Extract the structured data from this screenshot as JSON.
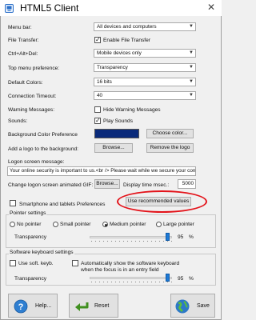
{
  "window": {
    "title": "HTML5 Client",
    "close_glyph": "✕"
  },
  "settings": {
    "menu_bar": {
      "label": "Menu bar:",
      "value": "All devices and computers"
    },
    "file_transfer": {
      "label": "File Transfer:",
      "checkbox_label": "Enable File Transfer",
      "checked": true
    },
    "ctrl_alt_del": {
      "label": "Ctrl+Alt+Del:",
      "value": "Mobile devices only"
    },
    "top_menu_pref": {
      "label": "Top menu preference:",
      "value": "Transparency"
    },
    "default_colors": {
      "label": "Default Colors:",
      "value": "16 bits"
    },
    "connection_timeout": {
      "label": "Connection Timeout:",
      "value": "40"
    },
    "warning_messages": {
      "label": "Warning Messages:",
      "checkbox_label": "Hide Warning Messages",
      "checked": false
    },
    "sounds": {
      "label": "Sounds:",
      "checkbox_label": "Play Sounds",
      "checked": true
    },
    "background_color": {
      "label": "Background Color Preference",
      "swatch": "#0a2a7a",
      "button": "Choose color..."
    },
    "logo_background": {
      "label": "Add a logo to the background:",
      "browse": "Browse...",
      "remove": "Remove the logo"
    },
    "logon_message": {
      "label": "Logon screen message:",
      "value": "Your online security is important to us.<br /> Please wait while we secure your conn"
    },
    "logon_gif": {
      "label": "Change logon screen animated GIF:",
      "browse": "Browse...",
      "display_time_label": "Display time msec.:",
      "display_time_value": "5000"
    },
    "smartphone": {
      "label": "Smartphone and tablets Preferences",
      "button": "Use recommended values"
    }
  },
  "pointer": {
    "title": "Pointer settings",
    "options": [
      "No pointer",
      "Small pointer",
      "Medium pointer",
      "Large pointer"
    ],
    "selected": "Medium pointer",
    "transparency_label": "Transparency",
    "transparency_value": "95",
    "transparency_fraction": 0.95,
    "unit": "%"
  },
  "keyboard": {
    "title": "Software keyboard settings",
    "soft_keyb_label": "Use soft. keyb.",
    "soft_keyb_checked": false,
    "auto_show_label": "Automatically show the software keyboard",
    "auto_show_label2": "when the focus is in an entry field",
    "auto_show_checked": false,
    "transparency_label": "Transparency",
    "transparency_value": "95",
    "transparency_fraction": 0.95,
    "unit": "%"
  },
  "footer": {
    "help": "Help...",
    "reset": "Reset",
    "save": "Save"
  },
  "colors": {
    "accent": "#1e7ad6",
    "annotation": "#e3141b",
    "background": "#f0f0f0"
  }
}
